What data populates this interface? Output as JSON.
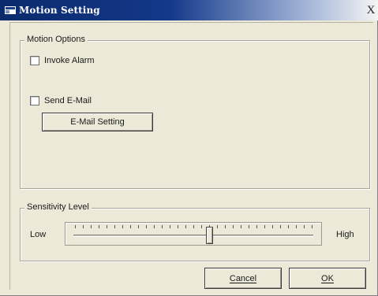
{
  "window": {
    "title": "Motion Setting",
    "close_glyph": "X"
  },
  "motion_options": {
    "group_label": "Motion Options",
    "invoke_alarm": {
      "label": "Invoke Alarm",
      "checked": false
    },
    "send_email": {
      "label": "Send E-Mail",
      "checked": false
    },
    "email_setting_button": "E-Mail Setting"
  },
  "sensitivity": {
    "group_label": "Sensitivity Level",
    "low_label": "Low",
    "high_label": "High",
    "tick_count": 31,
    "level_fraction": 0.57
  },
  "buttons": {
    "cancel_label": "Cancel",
    "ok_label": "OK"
  },
  "colors": {
    "title_bar_dark": "#0a2a6b",
    "dialog_face": "#ece9d8"
  },
  "icons": {
    "app": "window-app-icon",
    "close": "close-icon"
  }
}
